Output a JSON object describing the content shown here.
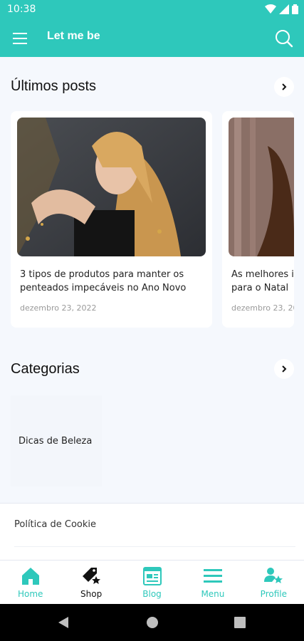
{
  "status_bar": {
    "time": "10:38"
  },
  "app_bar": {
    "title": "Let me be"
  },
  "latest_posts": {
    "title": "Últimos posts",
    "posts": [
      {
        "title_line1": "3 tipos de produtos para manter os",
        "title_line2": "penteados impecáveis no Ano Novo",
        "date": "dezembro 23, 2022"
      },
      {
        "title_line1": "As melhores i",
        "title_line2": "para o Natal",
        "date": "dezembro 23, 20"
      }
    ]
  },
  "categories": {
    "title": "Categorias",
    "items": [
      {
        "label": "Dicas de Beleza"
      }
    ]
  },
  "footer": {
    "cookie_label": "Política de Cookie"
  },
  "bottom_nav": {
    "items": [
      {
        "label": "Home",
        "icon": "home-icon"
      },
      {
        "label": "Shop",
        "icon": "shop-tag-icon"
      },
      {
        "label": "Blog",
        "icon": "blog-icon"
      },
      {
        "label": "Menu",
        "icon": "menu-icon"
      },
      {
        "label": "Profile",
        "icon": "profile-icon"
      }
    ]
  },
  "colors": {
    "accent": "#2ec8bb",
    "background": "#f5f8fd"
  }
}
